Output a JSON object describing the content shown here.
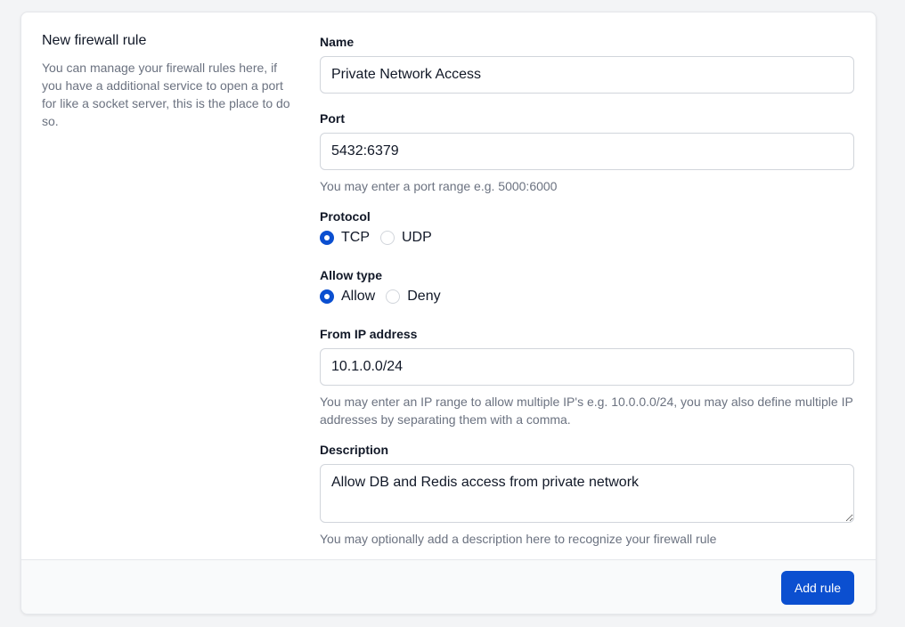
{
  "section": {
    "title": "New firewall rule",
    "description": "You can manage your firewall rules here, if you have a additional service to open a port for like a socket server, this is the place to do so."
  },
  "fields": {
    "name": {
      "label": "Name",
      "value": "Private Network Access"
    },
    "port": {
      "label": "Port",
      "value": "5432:6379",
      "hint": "You may enter a port range e.g. 5000:6000"
    },
    "protocol": {
      "label": "Protocol",
      "options": [
        "TCP",
        "UDP"
      ],
      "selected": "TCP"
    },
    "allow_type": {
      "label": "Allow type",
      "options": [
        "Allow",
        "Deny"
      ],
      "selected": "Allow"
    },
    "from_ip": {
      "label": "From IP address",
      "value": "10.1.0.0/24",
      "hint": "You may enter an IP range to allow multiple IP's e.g. 10.0.0.0/24, you may also define multiple IP addresses by separating them with a comma."
    },
    "description": {
      "label": "Description",
      "value": "Allow DB and Redis access from private network",
      "hint": "You may optionally add a description here to recognize your firewall rule"
    }
  },
  "footer": {
    "submit_label": "Add rule"
  },
  "colors": {
    "accent": "#0b4fd0",
    "muted_text": "#6b7280",
    "border": "#d1d5db"
  }
}
